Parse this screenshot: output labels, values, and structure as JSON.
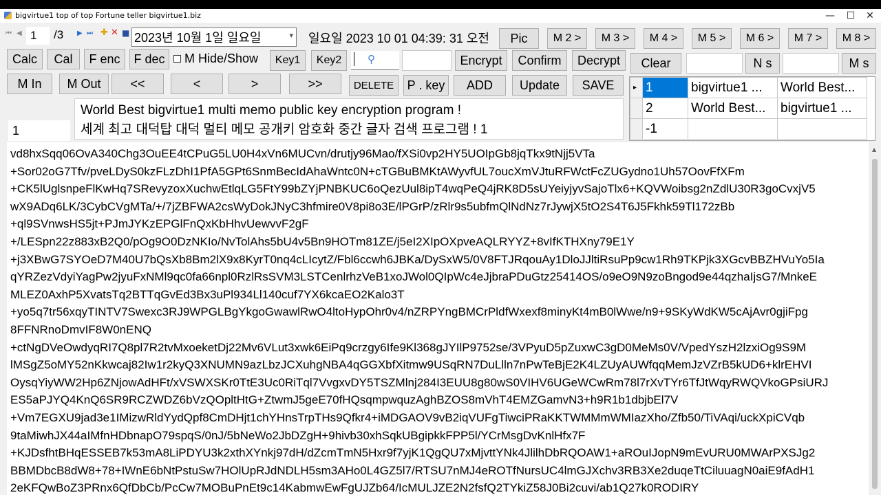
{
  "window": {
    "title": "bigvirtue1 top of top Fortune teller   bigvirtue1.biz",
    "controls": [
      "—",
      "☐",
      "✕"
    ]
  },
  "nav": {
    "page_current": "1",
    "page_total": "/3",
    "icons": [
      "first-icon",
      "prev-icon",
      "next-icon",
      "last-icon",
      "add-icon",
      "delete-icon",
      "save-icon"
    ],
    "date_value": "2023년 10월   1일 일요일",
    "datetime_text": "일요일 2023 10 01 04:39: 31 오전"
  },
  "row1": {
    "pic": "Pic",
    "m2": "M 2 >",
    "m3": "M 3 >",
    "m4": "M 4 >",
    "m5": "M 5 >",
    "m6": "M 6 >",
    "m7": "M 7 >",
    "m8": "M 8 >"
  },
  "row2": {
    "calc": "Calc",
    "cal": "Cal",
    "fenc": "F enc",
    "fdec": "F dec",
    "mhide": "M Hide/Show",
    "key1": "Key1",
    "key2": "Key2",
    "encrypt": "Encrypt",
    "confirm": "Confirm",
    "decrypt": "Decrypt",
    "clear": "Clear",
    "ns": "N s",
    "ms": "M s"
  },
  "row3": {
    "min": "M In",
    "mout": "M Out",
    "first": "<<",
    "prev": "<",
    "next": ">",
    "last": ">>",
    "delete": "DELETE",
    "pkey": "P . key",
    "add": "ADD",
    "update": "Update",
    "save": "SAVE"
  },
  "record_number": "1",
  "memo_title": {
    "line1": "World Best bigvirtue1 multi memo public key encryption program !",
    "line2": "세계 최고 대덕탑 대덕 멀티 메모 공개키 암호화 중간 글자 검색 프로그램 ! 1"
  },
  "grid": {
    "rows": [
      {
        "marker": "▸",
        "id": "1",
        "col2": "bigvirtue1 ...",
        "col3": "World Best..."
      },
      {
        "marker": "",
        "id": "2",
        "col2": "World Best...",
        "col3": "bigvirtue1 ..."
      },
      {
        "marker": "",
        "id": "-1",
        "col2": "",
        "col3": ""
      }
    ]
  },
  "encrypted_lines": [
    "vd8hxSqq06OvA340Chg3OuEE4tCPuG5LU0H4xVn6MUCvn/drutjy96Mao/fXSi0vp2HY5UOIpGb8jqTkx9tNjj5VTa",
    "+Sor02oG7Tfv/pveLDyS0kzFLzDhI1PfA5GPt6SnmBecIdAhaWntc0N+cTGBuBMKtAWyvfUL7oucXmVJtuRFWctFcZUGydno1Uh57OovFfXFm",
    "+CK5lUglsnpeFlKwHq7SRevyzoxXuchwEtlqLG5FtY99bZYjPNBKUC6oQezUul8ipT4wqPeQ4jRK8D5sUYeiyjyvSajoTlx6+KQVWoibsg2nZdlU30R3goCvxjV5",
    "wX9ADq6LK/3CybCVgMTa/+/7jZBFWA2csWyDokJNyC3hfmire0V8pi8o3E/lPGrP/zRlr9s5ubfmQlNdNz7rJywjX5tO2S4T6J5Fkhk59Tl172zBb",
    "+ql9SVnwsHS5jt+PJmJYKzEPGlFnQxKbHhvUewvvF2gF",
    "+/LESpn22z883xB2Q0/pOg9O0DzNKIo/NvTolAhs5bU4v5Bn9HOTm81ZE/j5eI2XIpOXpveAQLRYYZ+8vIfKTHXny79E1Y",
    "+j3XBwG7SYOeD7M40U7bQsXb8Bm2lX9x8KyrT0nq4cLIcytZ/Fbl6ccwh6JBKa/DySxW5/0V8FTJRqouAy1DloJJltiRsuPp9cw1Rh9TKPjk3XGcvBBZHVuYo5Ia",
    "qYRZezVdyiYagPw2jyuFxNMl9qc0fa66npl0RzlRsSVM3LSTCenlrhzVeB1xoJWol0QIpWc4eJjbraPDuGtz25414OS/o9eO9N9zoBngod9e44qzhaIjsG7/MnkeE",
    "MLEZ0AxhP5XvatsTq2BTTqGvEd3Bx3uPl934Ll140cuf7YX6kcaEO2Kalo3T",
    "+yo5q7tr56xqyTINTV7Swexc3RJ9WPGLBgYkgoGwawlRwO4ltoHypOhr0v4/nZRPYngBMCrPldfWxexf8minyKt4mB0lWwe/n9+9SKyWdKW5cAjAvr0gjiFpg",
    "8FFNRnoDmvIF8W0nENQ",
    "+ctNgDVeOwdyqRI7Q8pl7R2tvMxoeketDj22Mv6VLut3xwk6EiPq9crzgy6Ife9Kl368gJYIlP9752se/3VPyuD5pZuxwC3gD0MeMs0V/VpedYszH2lzxiOg9S9M",
    "lMSgZ5oMY52nKkwcaj82Iw1r2kyQ3XNUMN9azLbzJCXuhgNBA4qGGXbfXitmw9USqRN7DuLlln7nPwTeBjE2K4LZUyAUWfqqMemJzVZrB5kUD6+klrEHVI",
    "OysqYiyWW2Hp6ZNjowAdHFt/xVSWXSKr0TtE3Uc0RiTql7VvgxvDY5TSZMlnj284I3EUU8g80wS0VIHV6UGeWCwRm78l7rXvTYr6TfJtWqyRWQVkoGPsiURJ",
    "ES5aPJYQ4KnQ6SR9RCZWDZ6bVzQOpltHtG+ZtwmJ5geE70fHQsqmpwquzAghBZOS8mVhT4EMZGamvN3+h9R1b1dbjbEl7V",
    "+Vm7EGXU9jad3e1IMizwRldYydQpf8CmDHjt1chYHnsTrpTHs9Qfkr4+iMDGAOV9vB2iqVUFgTiwciPRaKKTWMMmWMIazXho/Zfb50/TiVAqi/uckXpiCVqb",
    "9taMiwhJX44aIMfnHDbnapO79spqS/0nJ/5bNeWo2JbDZgH+9hivb30xhSqkUBgipkkFPP5l/YCrMsgDvKnlHfx7F",
    "+KJDsfhtBHqESSEB7k53mA8LiPDYU3k2xthXYnkj97dH/dZcmTmN5Hxr9f7yjK1QgQU7xMjvttYNk4JlilhDbRQOAW1+aROuIJopN9mEvURU0MWArPXSJg2",
    "BBMDbcB8dW8+78+IWnE6bNtPstuSw7HOlUpRJdNDLH5sm3AHo0L4GZ5l7/RTSU7nMJ4eROTfNursUC4lmGJXchv3RB3Xe2duqeTtCiluuagN0aiE9fAdH1",
    "2eKFQwBoZ3PRnx6QfDbCb/PcCw7MOBuPnEt9c14KabmwEwFgUJZb64/IcMULJZE2N2fsfQ2TYkiZ58J0Bi2cuvi/ab1Q27k0RODIRY"
  ]
}
